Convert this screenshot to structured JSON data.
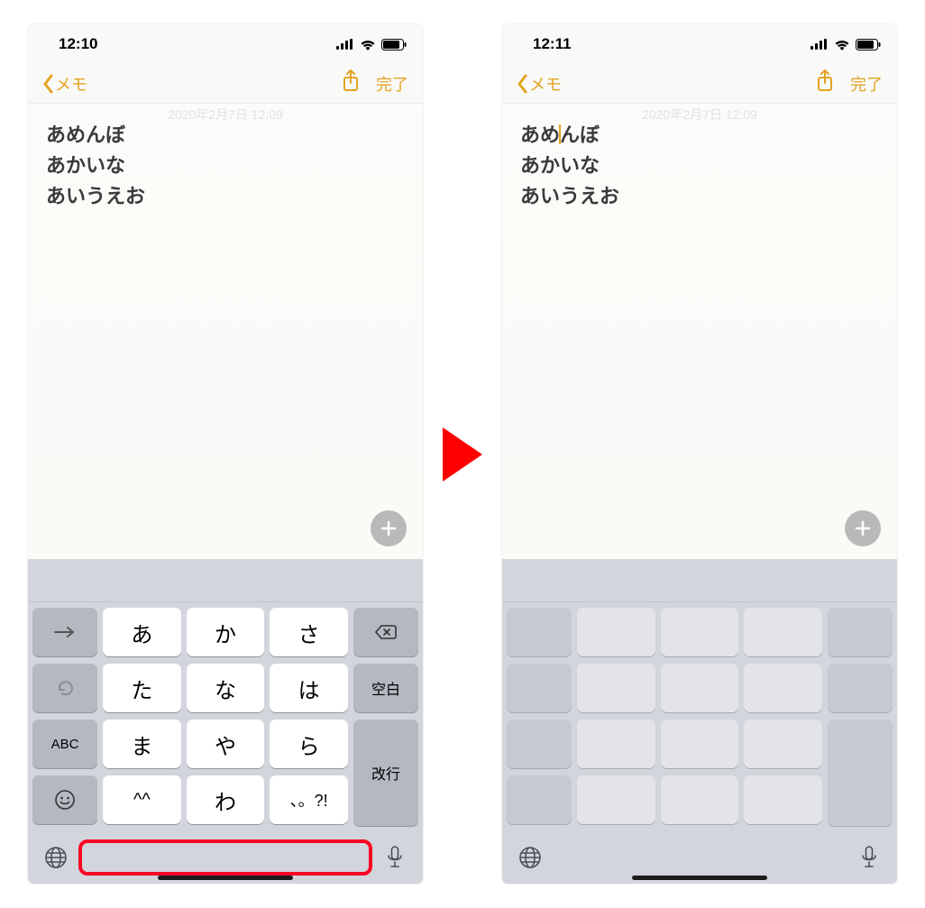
{
  "accent_color": "#e3a423",
  "arrow_color": "#ff0000",
  "highlight_color": "#ff0024",
  "left_phone": {
    "status": {
      "time": "12:10"
    },
    "nav": {
      "back_label": "メモ",
      "done_label": "完了"
    },
    "note": {
      "faint_timestamp": "2020年2月7日 12:09",
      "lines": [
        "あめんぼ",
        "あかいな",
        "あいうえお"
      ]
    },
    "keyboard": {
      "row1": {
        "side": "→",
        "keys": [
          "あ",
          "か",
          "さ"
        ],
        "right_icon": "delete"
      },
      "row2": {
        "side": "↺",
        "keys": [
          "た",
          "な",
          "は"
        ],
        "right": "空白"
      },
      "row3": {
        "side": "ABC",
        "keys": [
          "ま",
          "や",
          "ら"
        ],
        "right_tall": "改行"
      },
      "row4": {
        "side": "☺",
        "keys": [
          "^^",
          "わ",
          "、。?!"
        ],
        "wa_under": "ー"
      }
    }
  },
  "right_phone": {
    "status": {
      "time": "12:11"
    },
    "nav": {
      "back_label": "メモ",
      "done_label": "完了"
    },
    "note": {
      "faint_timestamp": "2020年2月7日 12:09",
      "line1_pre": "あめ",
      "line1_post": "んぼ",
      "line2": "あかいな",
      "line3": "あいうえお"
    }
  }
}
